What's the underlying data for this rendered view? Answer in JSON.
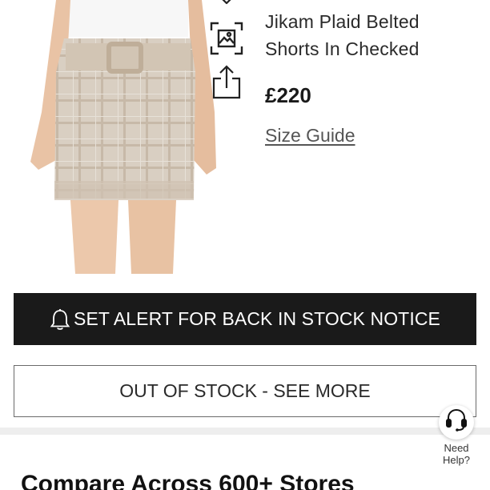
{
  "product": {
    "name_line1": "Jikam Plaid Belted",
    "name_line2": "Shorts In Checked",
    "price": "£220",
    "size_guide_label": "Size Guide",
    "image_alt": "Beige plaid belted mini shorts"
  },
  "icons": {
    "wishlist": "heart-icon",
    "visual_search": "image-search-icon",
    "share": "share-icon",
    "alert": "bell-icon",
    "help": "headset-icon"
  },
  "actions": {
    "alert_label": "SET ALERT FOR BACK IN STOCK NOTICE",
    "out_of_stock_label": "OUT OF STOCK - SEE MORE"
  },
  "help": {
    "line1": "Need",
    "line2": "Help?"
  },
  "compare": {
    "heading": "Compare Across 600+ Stores"
  },
  "colors": {
    "primary_dark": "#1a1a1a",
    "border": "#6a6a6a",
    "divider": "#eeeeee"
  }
}
